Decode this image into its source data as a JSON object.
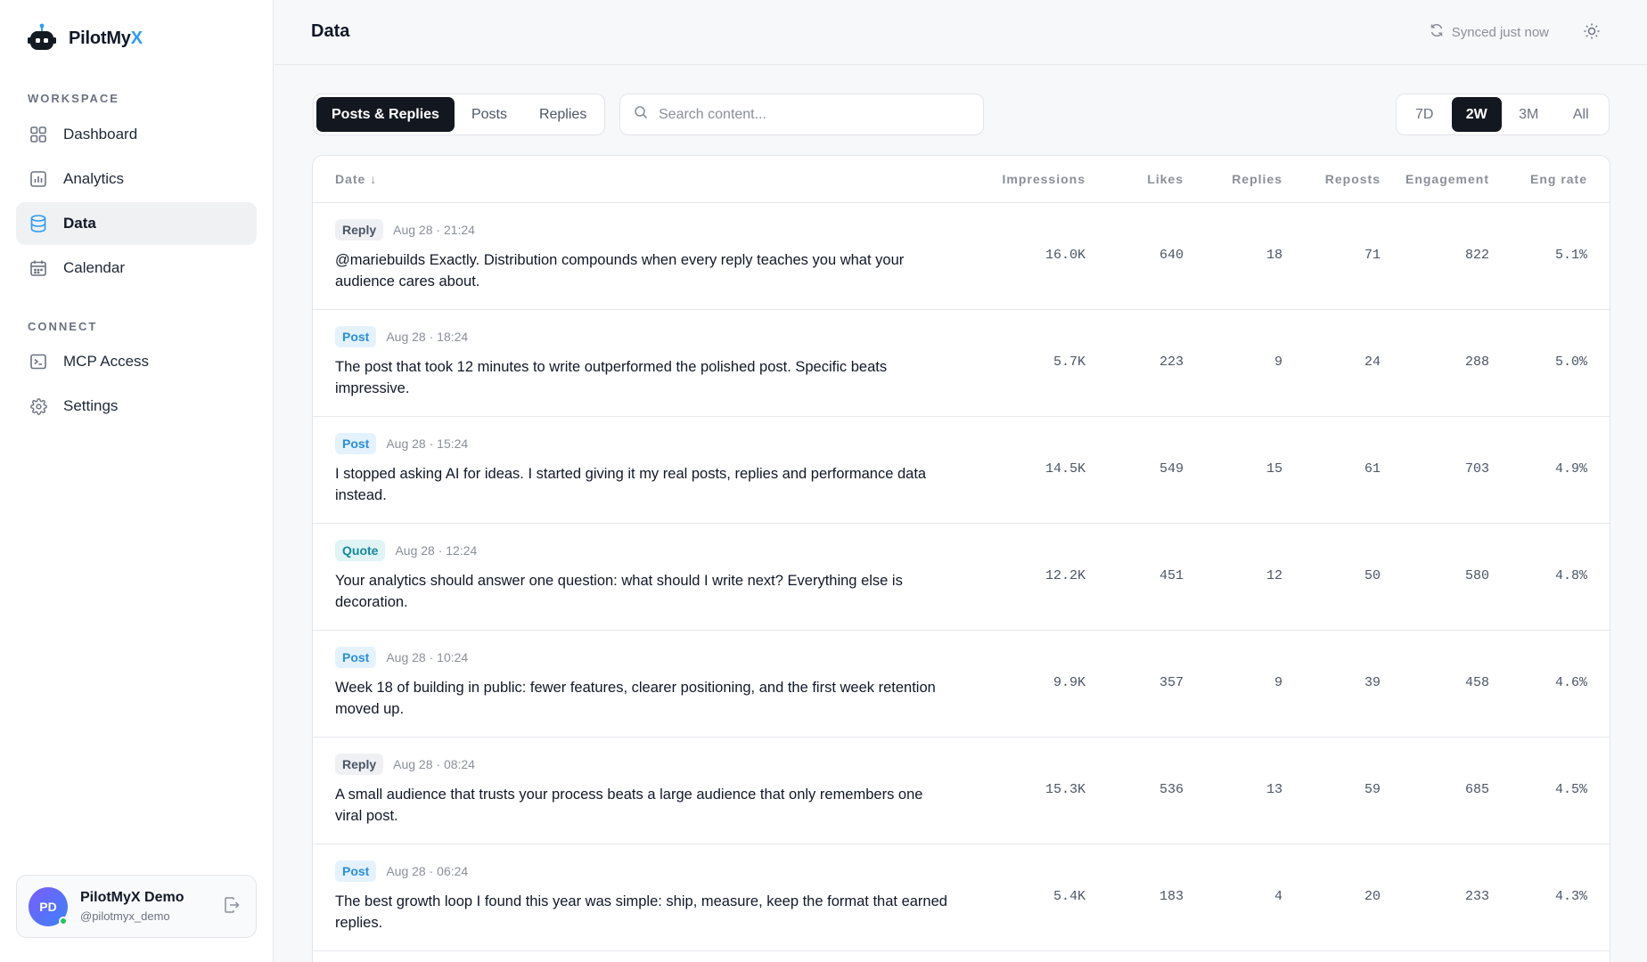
{
  "brand": {
    "name_main": "PilotMy",
    "name_accent": "X",
    "accent_color": "#2a9df4"
  },
  "sidebar": {
    "workspace_label": "WORKSPACE",
    "connect_label": "CONNECT",
    "items": [
      {
        "label": "Dashboard",
        "icon": "grid-icon"
      },
      {
        "label": "Analytics",
        "icon": "bar-chart-icon"
      },
      {
        "label": "Data",
        "icon": "database-icon",
        "active": true
      },
      {
        "label": "Calendar",
        "icon": "calendar-icon"
      },
      {
        "label": "MCP Access",
        "icon": "terminal-icon"
      },
      {
        "label": "Settings",
        "icon": "gear-icon"
      }
    ]
  },
  "user": {
    "initials": "PD",
    "name": "PilotMyX Demo",
    "handle": "@pilotmyx_demo",
    "status_color": "#22c55e"
  },
  "header": {
    "title": "Data",
    "sync_text": "Synced just now"
  },
  "filters": {
    "tabs": [
      "Posts & Replies",
      "Posts",
      "Replies"
    ],
    "active_tab": "Posts & Replies",
    "search_placeholder": "Search content...",
    "ranges": [
      "7D",
      "2W",
      "3M",
      "All"
    ],
    "active_range": "2W"
  },
  "table": {
    "columns": [
      "Date ↓",
      "Impressions",
      "Likes",
      "Replies",
      "Reposts",
      "Engagement",
      "Eng rate"
    ],
    "rows": [
      {
        "type": "Reply",
        "date": "Aug 28 · 21:24",
        "text": "@mariebuilds Exactly. Distribution compounds when every reply teaches you what your audience cares about.",
        "impressions": "16.0K",
        "likes": "640",
        "replies": "18",
        "reposts": "71",
        "engagement": "822",
        "rate": "5.1%"
      },
      {
        "type": "Post",
        "date": "Aug 28 · 18:24",
        "text": "The post that took 12 minutes to write outperformed the polished post. Specific beats impressive.",
        "impressions": "5.7K",
        "likes": "223",
        "replies": "9",
        "reposts": "24",
        "engagement": "288",
        "rate": "5.0%"
      },
      {
        "type": "Post",
        "date": "Aug 28 · 15:24",
        "text": "I stopped asking AI for ideas. I started giving it my real posts, replies and performance data instead.",
        "impressions": "14.5K",
        "likes": "549",
        "replies": "15",
        "reposts": "61",
        "engagement": "703",
        "rate": "4.9%"
      },
      {
        "type": "Quote",
        "date": "Aug 28 · 12:24",
        "text": "Your analytics should answer one question: what should I write next? Everything else is decoration.",
        "impressions": "12.2K",
        "likes": "451",
        "replies": "12",
        "reposts": "50",
        "engagement": "580",
        "rate": "4.8%"
      },
      {
        "type": "Post",
        "date": "Aug 28 · 10:24",
        "text": "Week 18 of building in public: fewer features, clearer positioning, and the first week retention moved up.",
        "impressions": "9.9K",
        "likes": "357",
        "replies": "9",
        "reposts": "39",
        "engagement": "458",
        "rate": "4.6%"
      },
      {
        "type": "Reply",
        "date": "Aug 28 · 08:24",
        "text": "A small audience that trusts your process beats a large audience that only remembers one viral post.",
        "impressions": "15.3K",
        "likes": "536",
        "replies": "13",
        "reposts": "59",
        "engagement": "685",
        "rate": "4.5%"
      },
      {
        "type": "Post",
        "date": "Aug 28 · 06:24",
        "text": "The best growth loop I found this year was simple: ship, measure, keep the format that earned replies.",
        "impressions": "5.4K",
        "likes": "183",
        "replies": "4",
        "reposts": "20",
        "engagement": "233",
        "rate": "4.3%"
      }
    ]
  }
}
